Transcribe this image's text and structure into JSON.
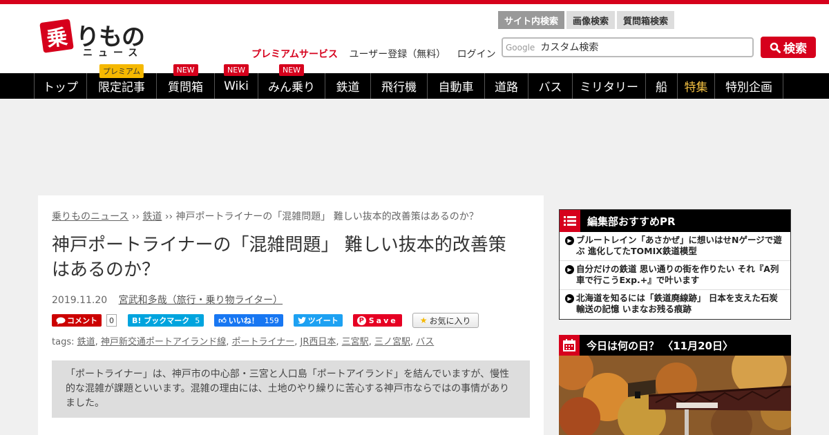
{
  "logo": {
    "kanji": "乗",
    "text": "りもの",
    "sub": "ニュース"
  },
  "header": {
    "premium_link": "プレミアムサービス",
    "register_link": "ユーザー登録（無料）",
    "login_link": "ログイン"
  },
  "search": {
    "tabs": [
      "サイト内検索",
      "画像検索",
      "質問箱検索"
    ],
    "google_label": "Google",
    "placeholder": "カスタム検索",
    "button_label": "検索"
  },
  "nav": {
    "items": [
      {
        "label": "トップ",
        "badge": ""
      },
      {
        "label": "限定記事",
        "badge": "プレミアム"
      },
      {
        "label": "質問箱",
        "badge": "NEW"
      },
      {
        "label": "Wiki",
        "badge": "NEW"
      },
      {
        "label": "みん乗り",
        "badge": "NEW"
      },
      {
        "label": "鉄道",
        "badge": ""
      },
      {
        "label": "飛行機",
        "badge": ""
      },
      {
        "label": "自動車",
        "badge": ""
      },
      {
        "label": "道路",
        "badge": ""
      },
      {
        "label": "バス",
        "badge": ""
      },
      {
        "label": "ミリタリー",
        "badge": ""
      },
      {
        "label": "船",
        "badge": ""
      },
      {
        "label": "特集",
        "badge": ""
      },
      {
        "label": "特別企画",
        "badge": ""
      }
    ]
  },
  "article": {
    "breadcrumb": {
      "home": "乗りものニュース",
      "sep": "››",
      "category": "鉄道",
      "current": "神戸ポートライナーの「混雑問題」 難しい抜本的改善策はあるのか？"
    },
    "title": "神戸ポートライナーの「混雑問題」 難しい抜本的改善策はあるのか？",
    "date": "2019.11.20",
    "author": "宮武和多哉（旅行・乗り物ライター）",
    "social": {
      "comment_label": "コメント",
      "comment_count": "0",
      "hatena_label": "B! ブックマーク",
      "hatena_count": "5",
      "fb_label": "いいね！",
      "fb_count": "159",
      "tw_label": "ツイート",
      "pin_label": "Save",
      "fav_label": "お気に入り"
    },
    "tags_label": "tags:",
    "tags": [
      "鉄道",
      "神戸新交通ポートアイランド線",
      "ポートライナー",
      "JR西日本",
      "三宮駅",
      "三ノ宮駅",
      "バス"
    ],
    "lead": "「ポートライナー」は、神戸市の中心部・三宮と人口島「ポートアイランド」を結んでいますが、慢性的な混雑が課題といいます。混雑の理由には、土地のやり繰りに苦心する神戸市ならではの事情がありました。"
  },
  "sidebar": {
    "recommend_title": "編集部おすすめPR",
    "recommend_items": [
      "ブルートレイン「あさかぜ」に想いはせNゲージで遊ぶ 進化してたTOMIX鉄道模型",
      "自分だけの鉄道 思い通りの街を作りたい それ『A列車で行こうExp.+』で叶います",
      "北海道を知るには「鉄道廃線跡」 日本を支えた石炭輸送の記憶 いまなお残る痕跡"
    ],
    "today_title": "今日は何の日？ 〈11月20日〉"
  },
  "colors": {
    "brand": "#d6001c",
    "nav_bg": "#000000",
    "special": "#f5c242"
  }
}
